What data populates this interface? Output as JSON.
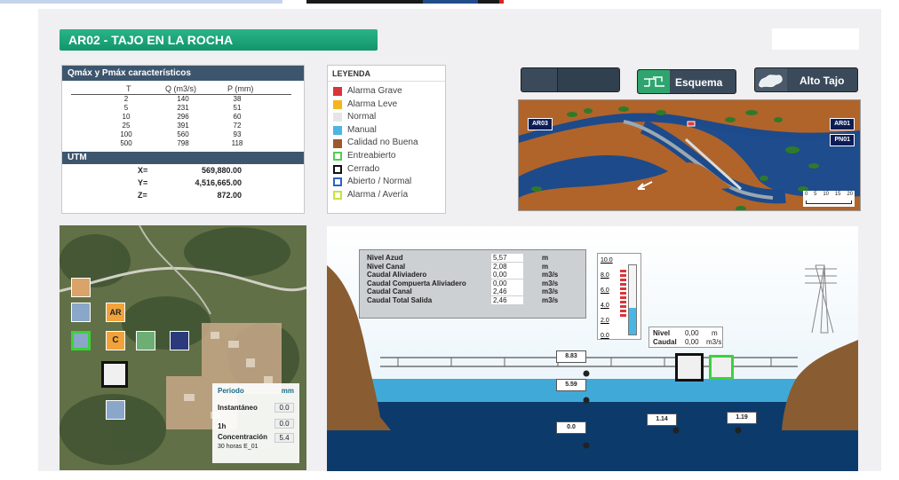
{
  "page": {
    "title": "AR02 - TAJO EN LA ROCHA"
  },
  "qtable": {
    "title": "Qmáx y Pmáx característicos",
    "col_t": "T",
    "col_q": "Q (m3/s)",
    "col_p": "P (mm)",
    "rows": [
      {
        "t": "2",
        "q": "140",
        "p": "38"
      },
      {
        "t": "5",
        "q": "231",
        "p": "51"
      },
      {
        "t": "10",
        "q": "296",
        "p": "60"
      },
      {
        "t": "25",
        "q": "391",
        "p": "72"
      },
      {
        "t": "100",
        "q": "560",
        "p": "93"
      },
      {
        "t": "500",
        "q": "798",
        "p": "118"
      }
    ],
    "utm_title": "UTM",
    "utm": [
      {
        "k": "X=",
        "v": "569,880.00"
      },
      {
        "k": "Y=",
        "v": "4,516,665.00"
      },
      {
        "k": "Z=",
        "v": "872.00"
      }
    ]
  },
  "legend": {
    "title": "LEYENDA",
    "items": [
      {
        "label": "Alarma Grave",
        "color": "#d9343a",
        "style": "fill"
      },
      {
        "label": "Alarma Leve",
        "color": "#f5b51c",
        "style": "fill"
      },
      {
        "label": "Normal",
        "color": "#e6e6e6",
        "style": "fill"
      },
      {
        "label": "Manual",
        "color": "#4bb5e3",
        "style": "fill"
      },
      {
        "label": "Calidad no Buena",
        "color": "#9a5a2a",
        "style": "fill"
      },
      {
        "label": "Entreabierto",
        "color": "#4fd14f",
        "style": "outline"
      },
      {
        "label": "Cerrado",
        "color": "#111111",
        "style": "outline"
      },
      {
        "label": "Abierto / Normal",
        "color": "#2a62c9",
        "style": "outline"
      },
      {
        "label": "Alarma / Avería",
        "color": "#c8e23a",
        "style": "outline"
      }
    ]
  },
  "toolbar": {
    "esquema_label": "Esquema",
    "alto_tajo_label": "Alto Tajo"
  },
  "map": {
    "tags": [
      "AR03",
      "AR01",
      "PN01"
    ],
    "scale_labels": [
      "0",
      "5",
      "10",
      "15",
      "20"
    ]
  },
  "aerial": {
    "icon_ar": "AR",
    "icon_c": "C",
    "periodo": {
      "header": "Periodo",
      "unit": "mm",
      "rows": [
        {
          "label": "Instantáneo",
          "value": "0.0"
        },
        {
          "label": "1h",
          "value": "0.0"
        },
        {
          "label": "Concentración",
          "value": "5.4"
        }
      ],
      "sub_label": "30 horas E_01"
    }
  },
  "scheme": {
    "info": [
      {
        "label": "Nivel Azud",
        "value": "5,57",
        "unit": "m"
      },
      {
        "label": "Nivel Canal",
        "value": "2,08",
        "unit": "m"
      },
      {
        "label": "Caudal Aliviadero",
        "value": "0,00",
        "unit": "m3/s"
      },
      {
        "label": "Caudal Compuerta Aliviadero",
        "value": "0,00",
        "unit": "m3/s"
      },
      {
        "label": "Caudal Canal",
        "value": "2,46",
        "unit": "m3/s"
      },
      {
        "label": "Caudal Total Salida",
        "value": "2,46",
        "unit": "m3/s"
      }
    ],
    "gauge_ticks": [
      "10.0",
      "8.0",
      "6.0",
      "4.0",
      "2.0",
      "0.0"
    ],
    "gauge_fill": 0.38,
    "nivel_box": {
      "nivel_label": "Nivel",
      "nivel_value": "0,00",
      "nivel_unit": "m",
      "caudal_label": "Caudal",
      "caudal_value": "0,00",
      "caudal_unit": "m3/s"
    },
    "level_boxes": [
      "8.83",
      "5.59",
      "0.0",
      "1.14",
      "1.19"
    ]
  }
}
